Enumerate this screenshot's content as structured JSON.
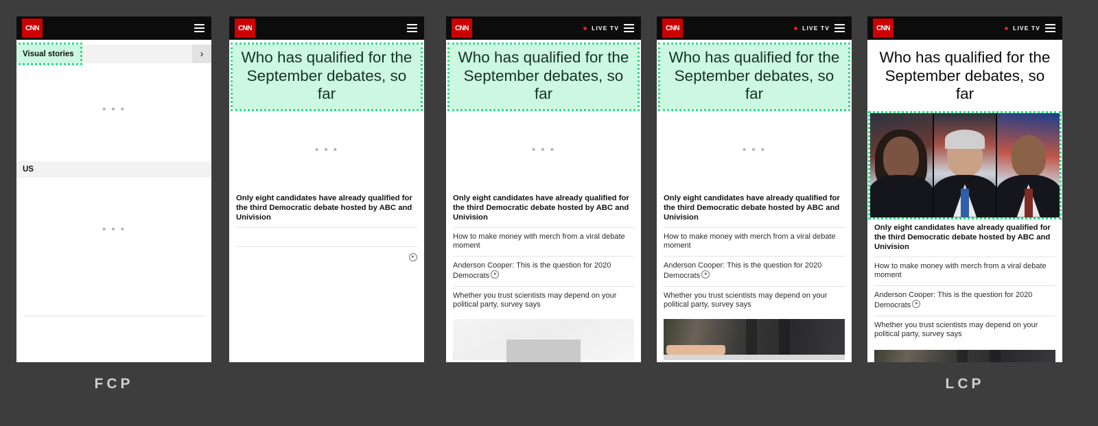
{
  "background_color": "#3d3d3d",
  "highlight": {
    "border_color": "#19e57f",
    "fill_color": "#ccf7e0"
  },
  "brand": {
    "logo_text": "CNN",
    "logo_color": "#cc0000",
    "header_bg": "#0c0c0c"
  },
  "captions": {
    "first": "FCP",
    "last": "LCP"
  },
  "article": {
    "headline": "Who has qualified for the September debates, so far",
    "subheadline": "Only eight candidates have already qualified for the third Democratic debate hosted by ABC and Univision",
    "links": [
      "How to make money with merch from a viral debate moment",
      "Anderson Cooper: This is the question for 2020 Democrats",
      "Whether you trust scientists may depend on your political party, survey says"
    ]
  },
  "nav": {
    "visual_stories": "Visual stories",
    "section_us": "US",
    "live_tv": "LIVE TV",
    "menu_icon": "hamburger-menu-icon",
    "arrow_icon": "chevron-right-icon",
    "loading_icon": "loading-ellipsis"
  },
  "loading": {
    "ellipsis": "• • •"
  },
  "frames": [
    {
      "id": "frame-1",
      "label": "FCP",
      "state": "first-contentful-paint",
      "has_live_tv": false,
      "highlighted": "visual-stories-strip"
    },
    {
      "id": "frame-2",
      "label": "",
      "state": "headline-painted",
      "has_live_tv": false,
      "highlighted": "headline"
    },
    {
      "id": "frame-3",
      "label": "",
      "state": "links-painted",
      "has_live_tv": true,
      "highlighted": "headline"
    },
    {
      "id": "frame-4",
      "label": "",
      "state": "bottom-image-loaded",
      "has_live_tv": true,
      "highlighted": "headline"
    },
    {
      "id": "frame-5",
      "label": "LCP",
      "state": "largest-contentful-paint",
      "has_live_tv": true,
      "highlighted": "hero-image"
    }
  ]
}
